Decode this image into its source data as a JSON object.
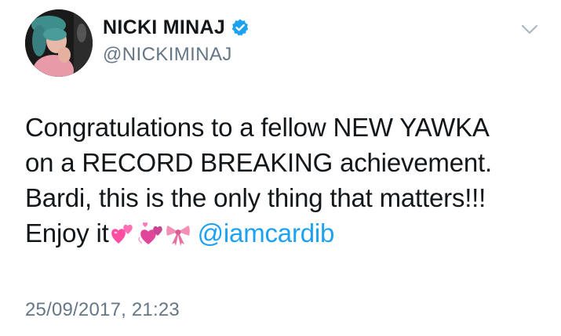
{
  "user": {
    "display_name": "NICKI MINAJ",
    "handle": "@NICKIMINAJ",
    "verified": true
  },
  "tweet": {
    "lines": [
      "Congratulations to a fellow NEW YAWKA",
      "on a RECORD BREAKING achievement.",
      "Bardi, this is the only thing that matters!!!",
      "Enjoy it"
    ],
    "emojis": [
      "two-hearts",
      "revolving-hearts",
      "ribbon"
    ],
    "mention": "@iamcardib",
    "timestamp": "25/09/2017, 21:23"
  },
  "colors": {
    "link": "#1da1f2",
    "secondary_text": "#657786",
    "verified": "#1da1f2"
  },
  "icons": {
    "verified": "verified-badge-icon",
    "more": "chevron-down-icon"
  }
}
